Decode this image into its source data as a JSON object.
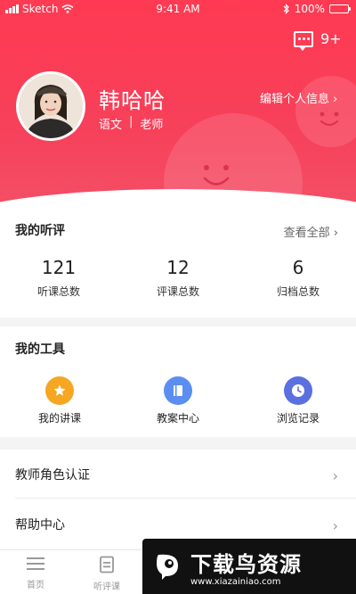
{
  "status_bar": {
    "carrier": "Sketch",
    "time": "9:41 AM",
    "battery": "100%"
  },
  "header": {
    "message_count": "9+",
    "name": "韩哈哈",
    "subject": "语文",
    "separator": "|",
    "role": "老师",
    "edit_profile": "编辑个人信息 ›"
  },
  "reviews": {
    "title": "我的听评",
    "view_all": "查看全部 ›",
    "stats": [
      {
        "value": "121",
        "label": "听课总数"
      },
      {
        "value": "12",
        "label": "评课总数"
      },
      {
        "value": "6",
        "label": "归档总数"
      }
    ]
  },
  "tools": {
    "title": "我的工具",
    "items": [
      {
        "label": "我的讲课",
        "icon": "star-icon",
        "color": "#f5a623"
      },
      {
        "label": "教案中心",
        "icon": "book-icon",
        "color": "#5b8ef0"
      },
      {
        "label": "浏览记录",
        "icon": "clock-icon",
        "color": "#5a6fe0"
      }
    ]
  },
  "menu": {
    "items": [
      {
        "label": "教师角色认证",
        "chevron": "›"
      },
      {
        "label": "帮助中心",
        "chevron": "›"
      }
    ]
  },
  "tabbar": {
    "tabs": [
      {
        "label": "首页",
        "icon": "menu-icon"
      },
      {
        "label": "听评课",
        "icon": "doc-icon"
      }
    ]
  },
  "watermark": {
    "title": "下载鸟资源",
    "url": "www.xiazainiao.com"
  },
  "colors": {
    "accent": "#f7405a",
    "star": "#f5a623",
    "book": "#5b8ef0",
    "clock": "#5a6fe0"
  }
}
